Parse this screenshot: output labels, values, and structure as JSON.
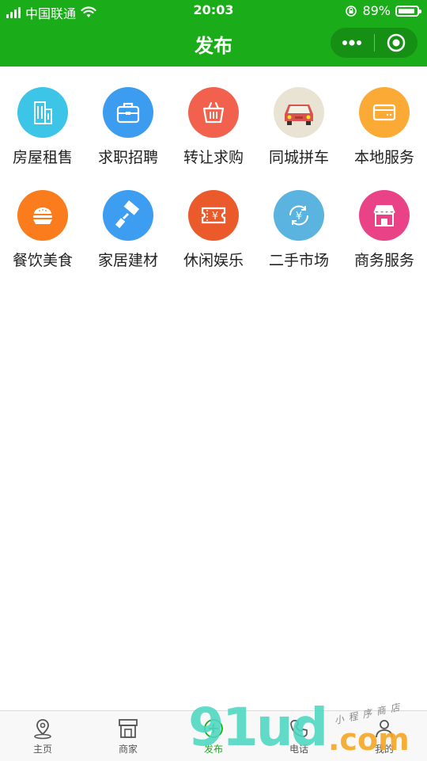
{
  "status_bar": {
    "carrier": "中国联通",
    "time": "20:03",
    "battery": "89%",
    "battery_level": 0.89
  },
  "nav": {
    "title": "发布"
  },
  "categories": [
    {
      "label": "房屋租售",
      "color": "#3cc5e6",
      "icon": "building-icon"
    },
    {
      "label": "求职招聘",
      "color": "#3c9cf0",
      "icon": "briefcase-icon"
    },
    {
      "label": "转让求购",
      "color": "#f2614e",
      "icon": "basket-icon"
    },
    {
      "label": "同城拼车",
      "color": "#e8e3d3",
      "icon": "car-icon"
    },
    {
      "label": "本地服务",
      "color": "#fbab35",
      "icon": "card-icon"
    },
    {
      "label": "餐饮美食",
      "color": "#fb7c1d",
      "icon": "burger-icon"
    },
    {
      "label": "家居建材",
      "color": "#3d9ef1",
      "icon": "paint-roller-icon"
    },
    {
      "label": "休闲娱乐",
      "color": "#eb5a2b",
      "icon": "ticket-icon"
    },
    {
      "label": "二手市场",
      "color": "#5ab4df",
      "icon": "yuan-cycle-icon"
    },
    {
      "label": "商务服务",
      "color": "#ea4287",
      "icon": "shop-icon"
    }
  ],
  "tabs": [
    {
      "label": "主页",
      "icon": "location-pin-icon"
    },
    {
      "label": "商家",
      "icon": "store-icon"
    },
    {
      "label": "发布",
      "icon": "plus-circle-icon"
    },
    {
      "label": "电话",
      "icon": "phone-icon"
    },
    {
      "label": "我的",
      "icon": "user-icon"
    }
  ],
  "watermark": {
    "main": "91ud",
    "suffix": ".com",
    "tagline": "小程序商店"
  }
}
